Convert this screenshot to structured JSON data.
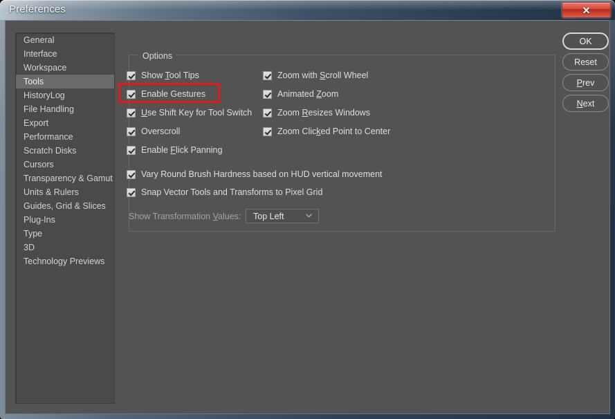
{
  "window": {
    "title": "Preferences",
    "close_label": "✕",
    "close_icon": "close-icon"
  },
  "sidebar": {
    "selected": "Tools",
    "items": [
      {
        "label": "General"
      },
      {
        "label": "Interface"
      },
      {
        "label": "Workspace"
      },
      {
        "label": "Tools"
      },
      {
        "label": "HistoryLog"
      },
      {
        "label": "File Handling"
      },
      {
        "label": "Export"
      },
      {
        "label": "Performance"
      },
      {
        "label": "Scratch Disks"
      },
      {
        "label": "Cursors"
      },
      {
        "label": "Transparency & Gamut"
      },
      {
        "label": "Units & Rulers"
      },
      {
        "label": "Guides, Grid & Slices"
      },
      {
        "label": "Plug-Ins"
      },
      {
        "label": "Type"
      },
      {
        "label": "3D"
      },
      {
        "label": "Technology Previews"
      }
    ]
  },
  "options": {
    "group_title": "Options",
    "left_column": [
      {
        "label": "Show ",
        "accel": "T",
        "label_after": "ool Tips",
        "checked": true
      },
      {
        "label": "Enable Gestures",
        "accel": "",
        "label_after": "",
        "checked": true
      },
      {
        "label": "",
        "accel": "U",
        "label_after": "se Shift Key for Tool Switch",
        "checked": true
      },
      {
        "label": "Overscroll",
        "accel": "",
        "label_after": "",
        "checked": true
      },
      {
        "label": "Enable ",
        "accel": "F",
        "label_after": "lick Panning",
        "checked": true
      }
    ],
    "right_column": [
      {
        "label": "Zoom with ",
        "accel": "S",
        "label_after": "croll Wheel",
        "checked": true
      },
      {
        "label": "Animated ",
        "accel": "Z",
        "label_after": "oom",
        "checked": true
      },
      {
        "label": "Zoom ",
        "accel": "R",
        "label_after": "esizes Windows",
        "checked": true
      },
      {
        "label": "Zoom Clic",
        "accel": "k",
        "label_after": "ed Point to Center",
        "checked": true
      }
    ],
    "full_width_rows": [
      {
        "label": "Vary Round Brush Hardness based on HUD vertical movement",
        "accel": "",
        "label_after": "",
        "checked": true
      },
      {
        "label": "Snap Vector Tools and Transforms to Pixel Grid",
        "accel": "",
        "label_after": "",
        "checked": true
      }
    ],
    "transformation": {
      "label_before": "Show Transformation ",
      "label_accel": "V",
      "label_after": "alues:",
      "value": "Top Left",
      "arrow_icon": "chevron-down-icon",
      "disabled": true
    }
  },
  "buttons": [
    {
      "label_before": "OK",
      "accel": "",
      "label_after": "",
      "default": true
    },
    {
      "label_before": "Reset",
      "accel": "",
      "label_after": "",
      "default": false
    },
    {
      "label_before": "",
      "accel": "P",
      "label_after": "rev",
      "default": false
    },
    {
      "label_before": "",
      "accel": "N",
      "label_after": "ext",
      "default": false
    }
  ],
  "annotation": {
    "color": "#e31b1b",
    "target": "Enable Gestures"
  }
}
